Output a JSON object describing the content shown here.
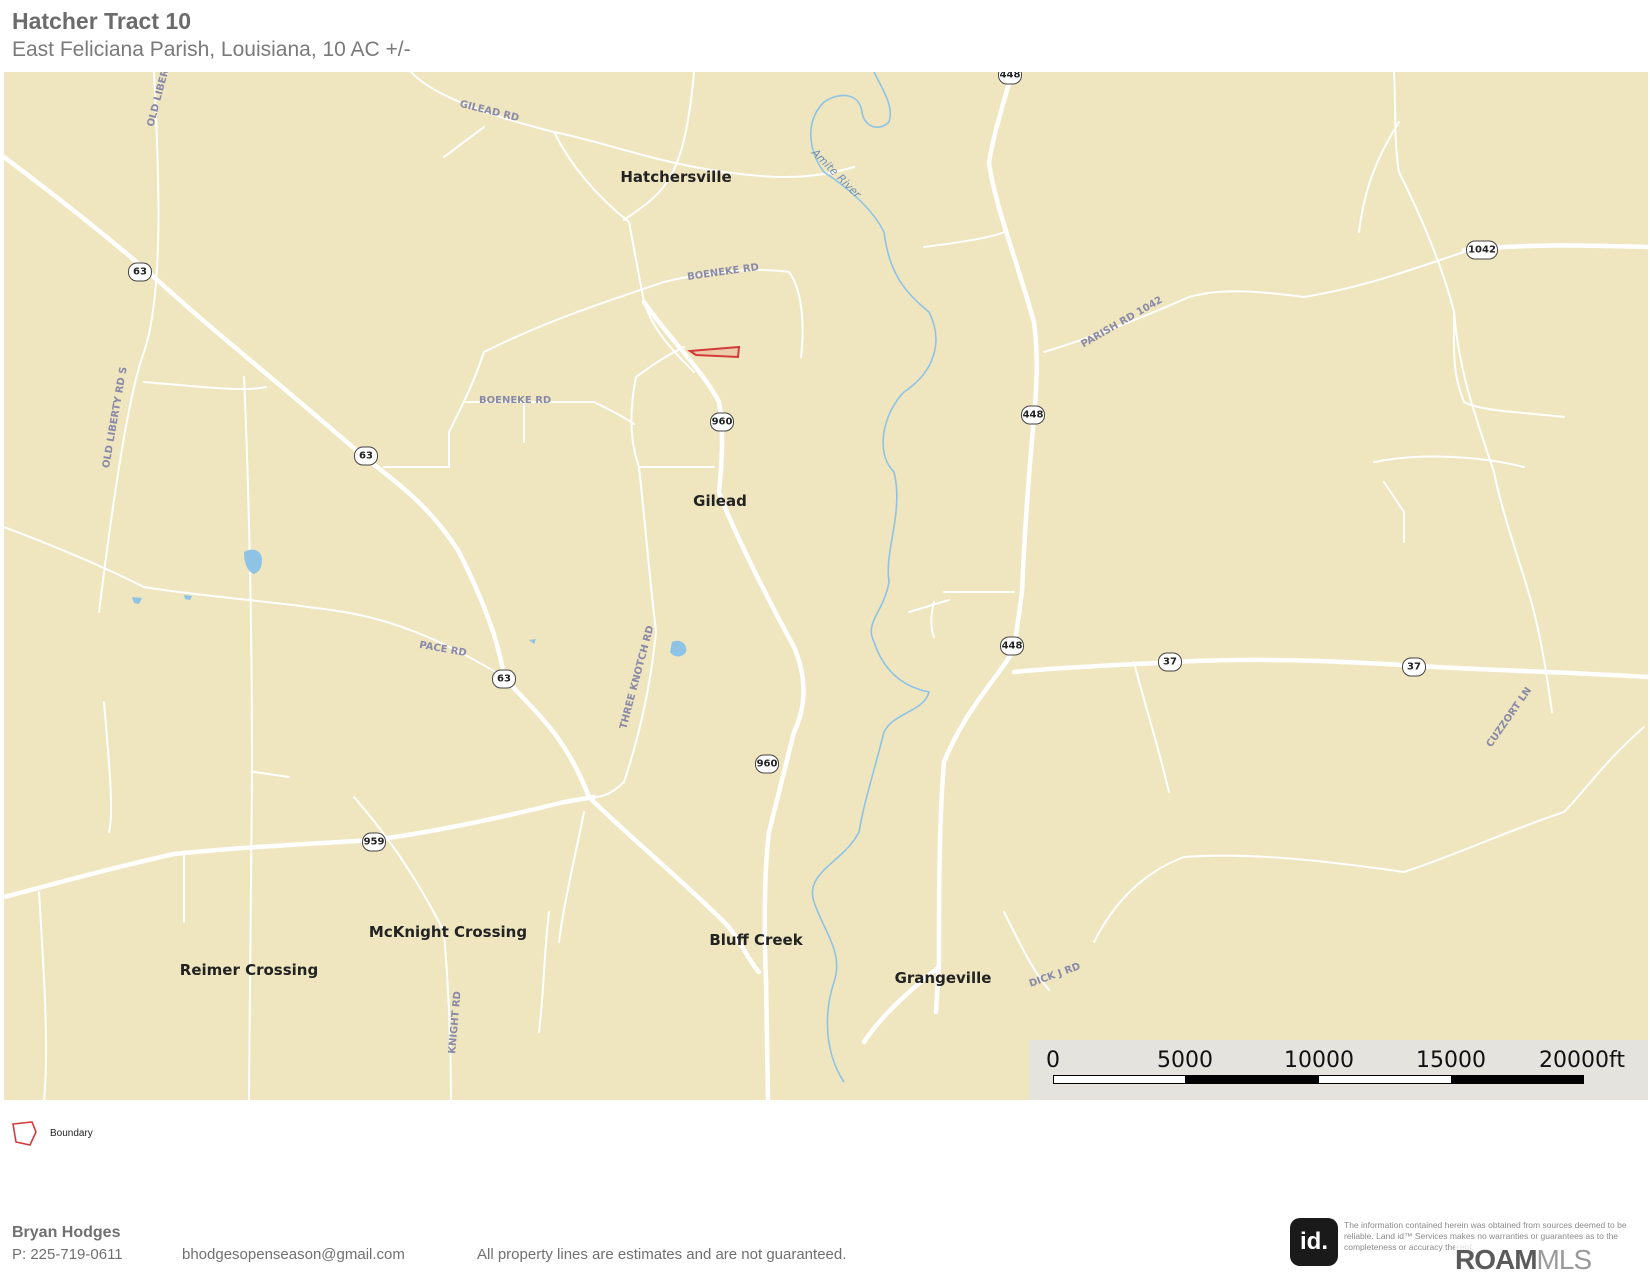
{
  "header": {
    "title": "Hatcher Tract 10",
    "subtitle": "East Feliciana Parish, Louisiana, 10 AC +/-"
  },
  "map": {
    "land_color": "#efe6bf",
    "road_color": "#ffffff",
    "water_color": "#8ec3e6",
    "boundary_color": "#d43a3a",
    "places": [
      "Hatchersville",
      "Gilead",
      "McKnight Crossing",
      "Bluff Creek",
      "Reimer Crossing",
      "Grangeville"
    ],
    "road_labels": [
      "GILEAD RD",
      "BOENEKE RD",
      "BOENEKE RD",
      "OLD LIBERTY RD S",
      "OLD LIBERTY",
      "PACE RD",
      "THREE KNOTCH RD",
      "PARISH RD 1042",
      "CUZZORT LN",
      "DICK J RD",
      "KNIGHT RD"
    ],
    "water_labels": [
      "Amite River"
    ],
    "shields": [
      "448",
      "63",
      "63",
      "63",
      "960",
      "960",
      "448",
      "448",
      "1042",
      "37",
      "37",
      "959"
    ]
  },
  "scale_bar": {
    "ticks": [
      "0",
      "5000",
      "10000",
      "15000",
      "20000ft"
    ]
  },
  "legend": {
    "icon": "boundary-polygon-icon",
    "label": "Boundary"
  },
  "footer": {
    "agent_name": "Bryan Hodges",
    "phone": "P: 225-719-0611",
    "email": "bhodgesopenseason@gmail.com",
    "disclaimer": "All property lines are estimates and are not guaranteed.",
    "logo_text": "id.",
    "fine_print": "The information contained herein was obtained from sources deemed to be reliable. Land id™ Services makes no warranties or guarantees as to the completeness or accuracy thereof.",
    "brand_roam": "ROAM",
    "brand_mls": "MLS"
  }
}
